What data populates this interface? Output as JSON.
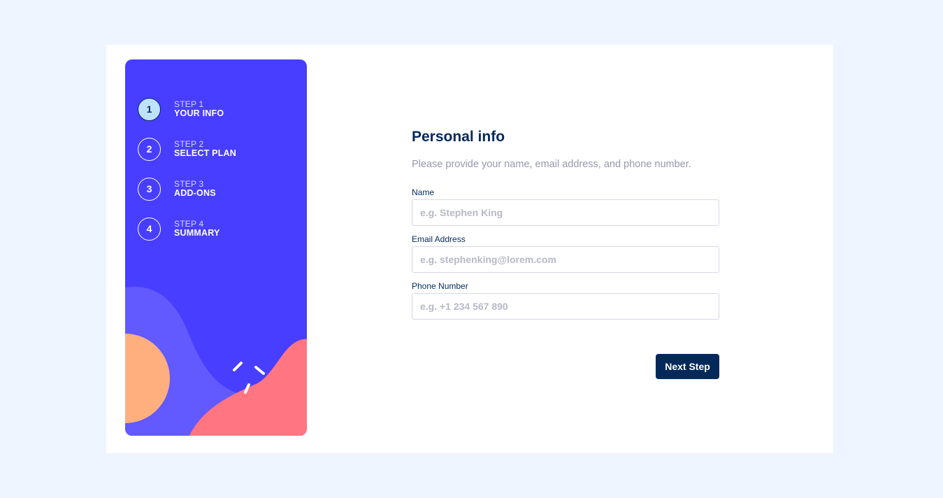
{
  "sidebar": {
    "steps": [
      {
        "number": "1",
        "label": "STEP 1",
        "title": "YOUR INFO",
        "active": true
      },
      {
        "number": "2",
        "label": "STEP 2",
        "title": "SELECT PLAN",
        "active": false
      },
      {
        "number": "3",
        "label": "STEP 3",
        "title": "ADD-ONS",
        "active": false
      },
      {
        "number": "4",
        "label": "STEP 4",
        "title": "SUMMARY",
        "active": false
      }
    ]
  },
  "form": {
    "title": "Personal info",
    "subtitle": "Please provide your name, email address, and phone number.",
    "fields": {
      "name": {
        "label": "Name",
        "placeholder": "e.g. Stephen King",
        "value": ""
      },
      "email": {
        "label": "Email Address",
        "placeholder": "e.g. stephenking@lorem.com",
        "value": ""
      },
      "phone": {
        "label": "Phone Number",
        "placeholder": "e.g. +1 234 567 890",
        "value": ""
      }
    },
    "next_label": "Next Step"
  },
  "colors": {
    "page_bg": "#eef5ff",
    "sidebar_bg": "#483eff",
    "active_step_bg": "#bee2fd",
    "marine_blue": "#02295a",
    "wave_purple": "#6259ff",
    "blob_orange": "#ffaf7e",
    "blob_pink": "#ff7582"
  }
}
